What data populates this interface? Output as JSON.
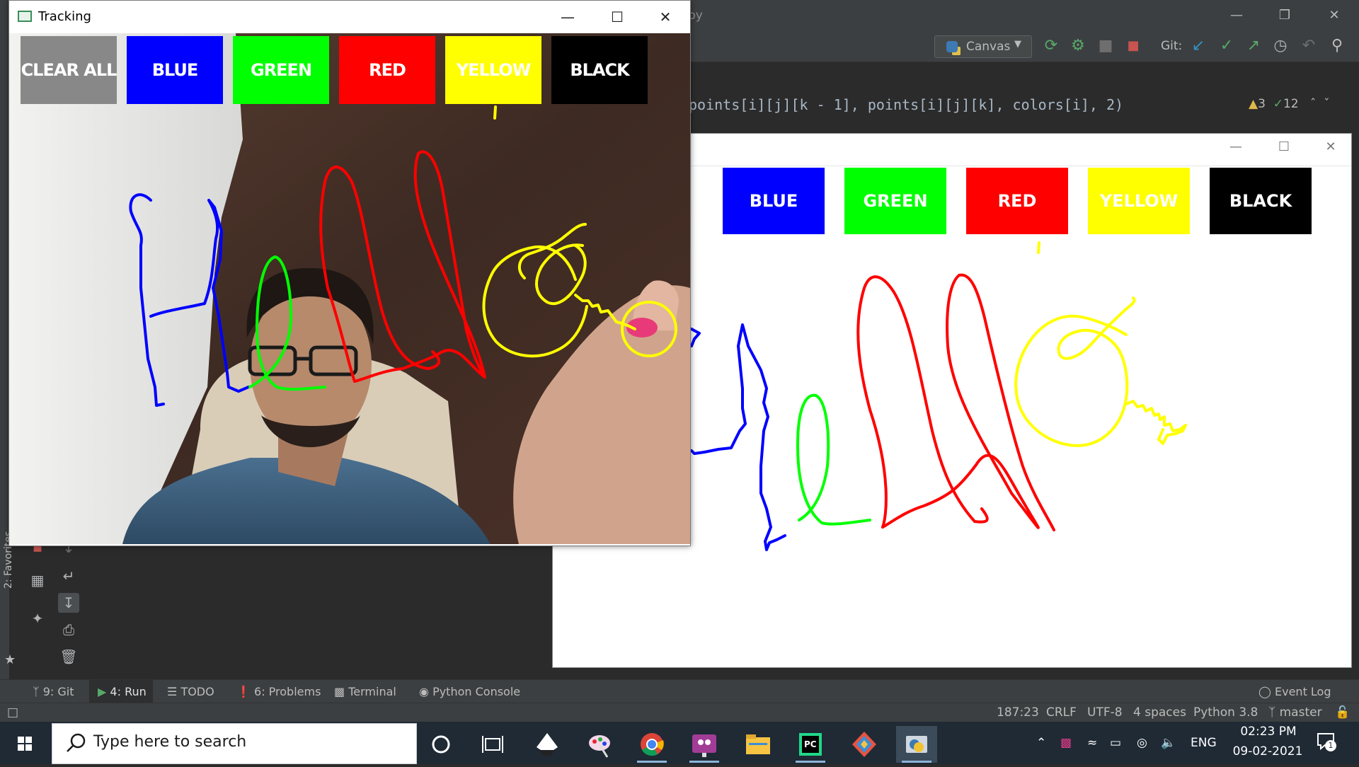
{
  "ide": {
    "title_fragment": "py",
    "run_config": "Canvas",
    "git_label": "Git:",
    "code_line": "points[i][j][k - 1], points[i][j][k], colors[i], 2)",
    "warnings": "3",
    "checks": "12",
    "favorites": "2: Favorites",
    "tool_tabs": {
      "git": "9: Git",
      "run": "4: Run",
      "todo": "TODO",
      "problems": "6: Problems",
      "terminal": "Terminal",
      "python_console": "Python Console",
      "event_log": "Event Log"
    },
    "status": {
      "position": "187:23",
      "line_sep": "CRLF",
      "encoding": "UTF-8",
      "indent": "4 spaces",
      "interpreter": "Python 3.8",
      "branch": "master"
    }
  },
  "tracking_window": {
    "title": "Tracking",
    "buttons": [
      "CLEAR ALL",
      "BLUE",
      "GREEN",
      "RED",
      "YELLOW",
      "BLACK"
    ]
  },
  "canvas_window": {
    "buttons": [
      "BLUE",
      "GREEN",
      "RED",
      "YELLOW",
      "BLACK"
    ]
  },
  "colors": {
    "blue": "#0000ff",
    "green": "#00ff00",
    "red": "#ff0000",
    "yellow": "#ffff00",
    "black": "#000000",
    "gray": "#888888"
  },
  "taskbar": {
    "search_placeholder": "Type here to search",
    "language": "ENG",
    "time": "02:23 PM",
    "date": "09-02-2021",
    "notifications": "1"
  }
}
